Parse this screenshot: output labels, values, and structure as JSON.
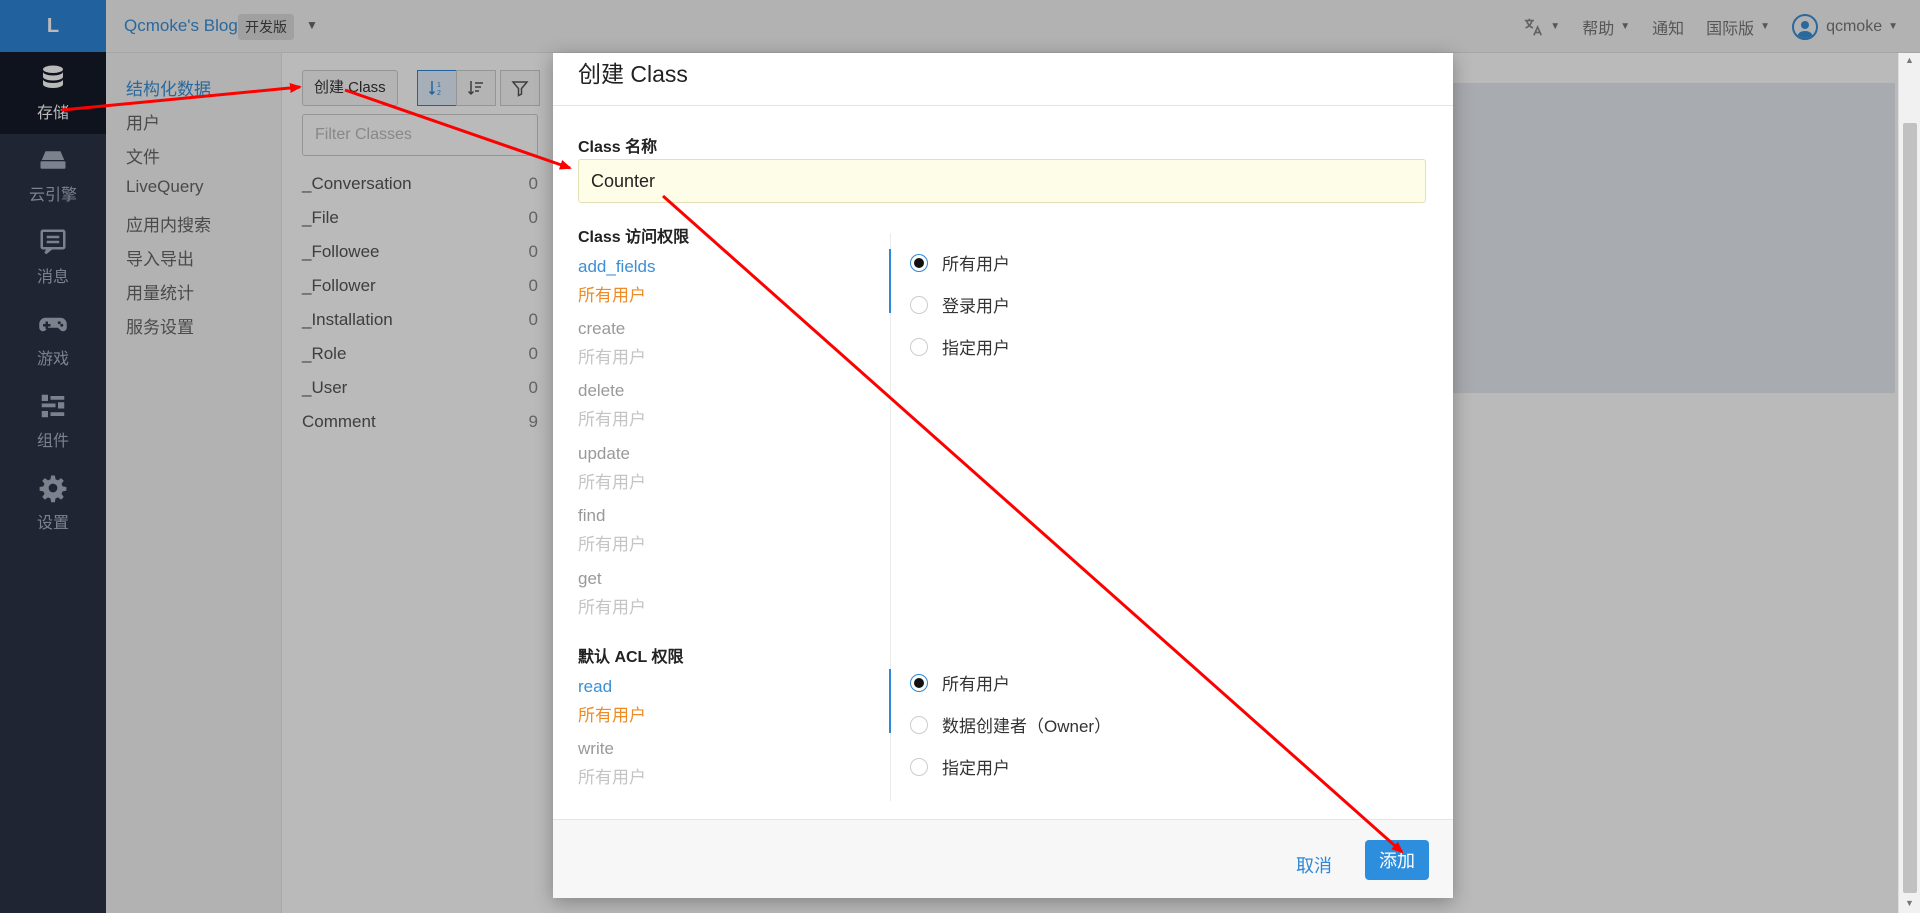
{
  "rail": {
    "logo": "L",
    "items": [
      {
        "label": "存储",
        "icon": "database-icon"
      },
      {
        "label": "云引擎",
        "icon": "server-icon"
      },
      {
        "label": "消息",
        "icon": "message-icon"
      },
      {
        "label": "游戏",
        "icon": "gamepad-icon"
      },
      {
        "label": "组件",
        "icon": "components-icon"
      },
      {
        "label": "设置",
        "icon": "gear-icon"
      }
    ]
  },
  "topbar": {
    "app_name": "Qcmoke's Blog",
    "env_badge": "开发版",
    "help": "帮助",
    "notify": "通知",
    "region": "国际版",
    "user": "qcmoke"
  },
  "subnav": {
    "items": [
      "结构化数据",
      "用户",
      "文件",
      "LiveQuery",
      "应用内搜索",
      "导入导出",
      "用量统计",
      "服务设置"
    ]
  },
  "classes": {
    "create_label": "创建 Class",
    "filter_placeholder": "Filter Classes",
    "rows": [
      {
        "name": "_Conversation",
        "count": "0"
      },
      {
        "name": "_File",
        "count": "0"
      },
      {
        "name": "_Followee",
        "count": "0"
      },
      {
        "name": "_Follower",
        "count": "0"
      },
      {
        "name": "_Installation",
        "count": "0"
      },
      {
        "name": "_Role",
        "count": "0"
      },
      {
        "name": "_User",
        "count": "0"
      },
      {
        "name": "Comment",
        "count": "9"
      }
    ]
  },
  "modal": {
    "title": "创建 Class",
    "name_label": "Class 名称",
    "name_value": "Counter",
    "access_label": "Class 访问权限",
    "access_perms": [
      {
        "name": "add_fields",
        "value": "所有用户"
      },
      {
        "name": "create",
        "value": "所有用户"
      },
      {
        "name": "delete",
        "value": "所有用户"
      },
      {
        "name": "update",
        "value": "所有用户"
      },
      {
        "name": "find",
        "value": "所有用户"
      },
      {
        "name": "get",
        "value": "所有用户"
      }
    ],
    "access_options": [
      "所有用户",
      "登录用户",
      "指定用户"
    ],
    "acl_label": "默认 ACL 权限",
    "acl_perms": [
      {
        "name": "read",
        "value": "所有用户"
      },
      {
        "name": "write",
        "value": "所有用户"
      }
    ],
    "acl_options": [
      "所有用户",
      "数据创建者（Owner）",
      "指定用户"
    ],
    "cancel": "取消",
    "add": "添加"
  },
  "colors": {
    "accent": "#2e87d9",
    "rail_bg": "#2c3447",
    "annotation": "#ff0000",
    "perm_active_value": "#f08a24"
  }
}
